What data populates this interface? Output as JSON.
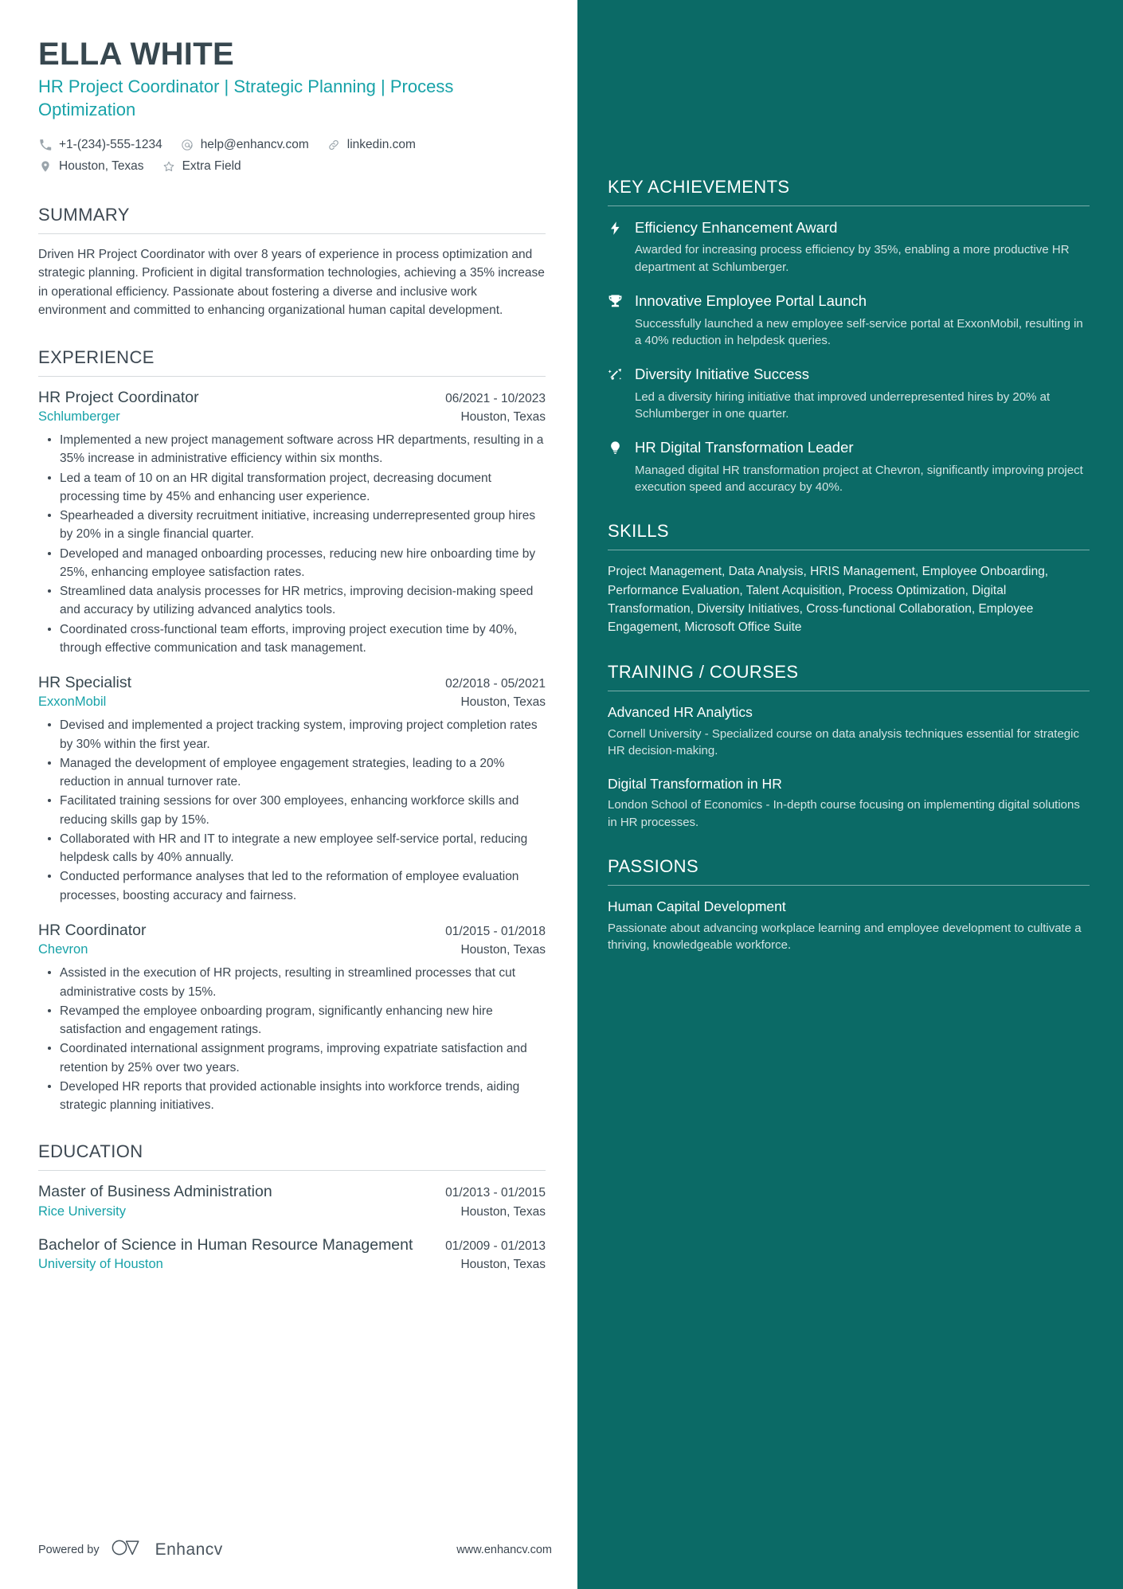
{
  "header": {
    "name": "ELLA WHITE",
    "headline": "HR Project Coordinator | Strategic Planning | Process Optimization",
    "contacts_line1": [
      {
        "icon": "phone-icon",
        "text": "+1-(234)-555-1234"
      },
      {
        "icon": "email-icon",
        "text": "help@enhancv.com"
      },
      {
        "icon": "link-icon",
        "text": "linkedin.com"
      }
    ],
    "contacts_line2": [
      {
        "icon": "location-pin-icon",
        "text": "Houston, Texas"
      },
      {
        "icon": "star-icon",
        "text": "Extra Field"
      }
    ]
  },
  "summary": {
    "title": "SUMMARY",
    "text": "Driven HR Project Coordinator with over 8 years of experience in process optimization and strategic planning. Proficient in digital transformation technologies, achieving a 35% increase in operational efficiency. Passionate about fostering a diverse and inclusive work environment and committed to enhancing organizational human capital development."
  },
  "experience": {
    "title": "EXPERIENCE",
    "entries": [
      {
        "position": "HR Project Coordinator",
        "dates": "06/2021 - 10/2023",
        "company": "Schlumberger",
        "location": "Houston, Texas",
        "bullets": [
          "Implemented a new project management software across HR departments, resulting in a 35% increase in administrative efficiency within six months.",
          "Led a team of 10 on an HR digital transformation project, decreasing document processing time by 45% and enhancing user experience.",
          "Spearheaded a diversity recruitment initiative, increasing underrepresented group hires by 20% in a single financial quarter.",
          "Developed and managed onboarding processes, reducing new hire onboarding time by 25%, enhancing employee satisfaction rates.",
          "Streamlined data analysis processes for HR metrics, improving decision-making speed and accuracy by utilizing advanced analytics tools.",
          "Coordinated cross-functional team efforts, improving project execution time by 40%, through effective communication and task management."
        ]
      },
      {
        "position": "HR Specialist",
        "dates": "02/2018 - 05/2021",
        "company": "ExxonMobil",
        "location": "Houston, Texas",
        "bullets": [
          "Devised and implemented a project tracking system, improving project completion rates by 30% within the first year.",
          "Managed the development of employee engagement strategies, leading to a 20% reduction in annual turnover rate.",
          "Facilitated training sessions for over 300 employees, enhancing workforce skills and reducing skills gap by 15%.",
          "Collaborated with HR and IT to integrate a new employee self-service portal, reducing helpdesk calls by 40% annually.",
          "Conducted performance analyses that led to the reformation of employee evaluation processes, boosting accuracy and fairness."
        ]
      },
      {
        "position": "HR Coordinator",
        "dates": "01/2015 - 01/2018",
        "company": "Chevron",
        "location": "Houston, Texas",
        "bullets": [
          "Assisted in the execution of HR projects, resulting in streamlined processes that cut administrative costs by 15%.",
          "Revamped the employee onboarding program, significantly enhancing new hire satisfaction and engagement ratings.",
          "Coordinated international assignment programs, improving expatriate satisfaction and retention by 25% over two years.",
          "Developed HR reports that provided actionable insights into workforce trends, aiding strategic planning initiatives."
        ]
      }
    ]
  },
  "education": {
    "title": "EDUCATION",
    "entries": [
      {
        "degree": "Master of Business Administration",
        "dates": "01/2013 - 01/2015",
        "school": "Rice University",
        "location": "Houston, Texas"
      },
      {
        "degree": "Bachelor of Science in Human Resource Management",
        "dates": "01/2009 - 01/2013",
        "school": "University of Houston",
        "location": "Houston, Texas"
      }
    ]
  },
  "achievements": {
    "title": "KEY ACHIEVEMENTS",
    "items": [
      {
        "icon": "lightning-bolt-icon",
        "title": "Efficiency Enhancement Award",
        "desc": "Awarded for increasing process efficiency by 35%, enabling a more productive HR department at Schlumberger."
      },
      {
        "icon": "trophy-icon",
        "title": "Innovative Employee Portal Launch",
        "desc": "Successfully launched a new employee self-service portal at ExxonMobil, resulting in a 40% reduction in helpdesk queries."
      },
      {
        "icon": "rocket-trend-icon",
        "title": "Diversity Initiative Success",
        "desc": "Led a diversity hiring initiative that improved underrepresented hires by 20% at Schlumberger in one quarter."
      },
      {
        "icon": "lightbulb-icon",
        "title": "HR Digital Transformation Leader",
        "desc": "Managed digital HR transformation project at Chevron, significantly improving project execution speed and accuracy by 40%."
      }
    ]
  },
  "skills": {
    "title": "SKILLS",
    "text": "Project Management, Data Analysis, HRIS Management, Employee Onboarding, Performance Evaluation, Talent Acquisition, Process Optimization, Digital Transformation, Diversity Initiatives, Cross-functional Collaboration, Employee Engagement, Microsoft Office Suite"
  },
  "training": {
    "title": "TRAINING / COURSES",
    "items": [
      {
        "title": "Advanced HR Analytics",
        "desc": "Cornell University - Specialized course on data analysis techniques essential for strategic HR decision-making."
      },
      {
        "title": "Digital Transformation in HR",
        "desc": "London School of Economics - In-depth course focusing on implementing digital solutions in HR processes."
      }
    ]
  },
  "passions": {
    "title": "PASSIONS",
    "items": [
      {
        "title": "Human Capital Development",
        "desc": "Passionate about advancing workplace learning and employee development to cultivate a thriving, knowledgeable workforce."
      }
    ]
  },
  "footer": {
    "powered_label": "Powered by",
    "brand": "Enhancv",
    "url": "www.enhancv.com"
  },
  "colors": {
    "accent_teal": "#17a2a8",
    "sidebar_bg": "#0b6a66",
    "heading": "#37474f",
    "body_text": "#3d4852"
  }
}
